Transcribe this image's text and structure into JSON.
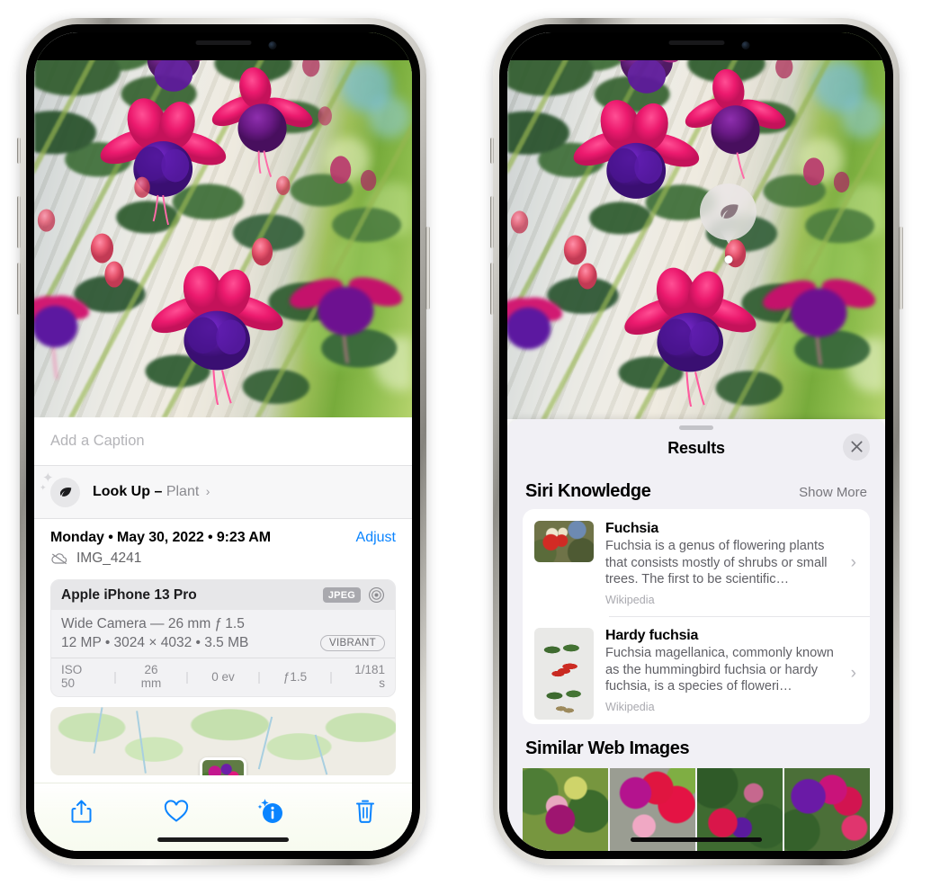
{
  "left_phone": {
    "caption_placeholder": "Add a Caption",
    "lookup": {
      "label": "Look Up",
      "dash": "–",
      "subject": "Plant",
      "chevron": "›",
      "icon": "leaf-icon"
    },
    "meta": {
      "date": "Monday • May 30, 2022 • 9:23 AM",
      "adjust_label": "Adjust",
      "filename": "IMG_4241",
      "cloud_icon": "icloud-slash-icon"
    },
    "camera_card": {
      "device": "Apple iPhone 13 Pro",
      "format_badge": "JPEG",
      "aperture_icon": "aperture-icon",
      "lens": "Wide Camera — 26 mm ƒ 1.5",
      "specs": "12 MP • 3024 × 4032 • 3.5 MB",
      "style_badge": "VIBRANT",
      "exif": [
        "ISO 50",
        "26 mm",
        "0 ev",
        "ƒ1.5",
        "1/181 s"
      ]
    },
    "toolbar": [
      {
        "name": "share-button",
        "icon": "share-icon"
      },
      {
        "name": "favorite-button",
        "icon": "heart-icon"
      },
      {
        "name": "info-button",
        "icon": "info-sparkle-icon"
      },
      {
        "name": "delete-button",
        "icon": "trash-icon"
      }
    ]
  },
  "right_phone": {
    "pin": {
      "icon": "leaf-icon"
    },
    "sheet": {
      "title": "Results",
      "close_icon": "close-icon",
      "grabber": "drag-handle"
    },
    "siri_knowledge": {
      "heading": "Siri Knowledge",
      "show_more": "Show More",
      "items": [
        {
          "title": "Fuchsia",
          "description": "Fuchsia is a genus of flowering plants that consists mostly of shrubs or small trees. The first to be scientific…",
          "source": "Wikipedia",
          "chevron": "›"
        },
        {
          "title": "Hardy fuchsia",
          "description": "Fuchsia magellanica, commonly known as the hummingbird fuchsia or hardy fuchsia, is a species of floweri…",
          "source": "Wikipedia",
          "chevron": "›"
        }
      ]
    },
    "similar_web_images": {
      "heading": "Similar Web Images",
      "count": 4
    }
  },
  "colors": {
    "accent_blue": "#0a84ff",
    "sheet_bg": "#f1f0f5",
    "card_bg": "#ffffff",
    "secondary_text": "#8a8a8f"
  }
}
